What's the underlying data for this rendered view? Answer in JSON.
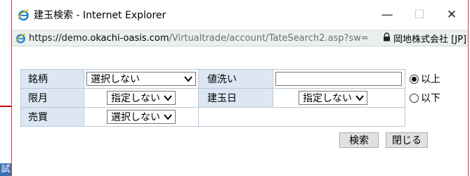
{
  "window": {
    "title": "建玉検索 - Internet Explorer",
    "minimize_glyph": "—",
    "maximize_glyph": "☐",
    "close_glyph": "✕"
  },
  "address_bar": {
    "url_scheme": "https://demo.",
    "url_host": "okachi-oasis.com",
    "url_path": "/Virtualtrade/account/TateSearch2.asp?sw=",
    "certificate": "岡地株式会社 [JP]",
    "icons": [
      "ie-icon",
      "lock-icon"
    ]
  },
  "form": {
    "meigara_label": "銘柄",
    "meigara_value": "選択しない",
    "nearai_label": "値洗い",
    "nearai_value": "",
    "gengetsu_label": "限月",
    "gengetsu_value": "指定しない",
    "tategyokubi_label": "建玉日",
    "tategyokubi_value": "指定しない",
    "baibai_label": "売買",
    "baibai_value": "選択しない",
    "radio_above_label": "以上",
    "radio_below_label": "以下",
    "radio_selected": "以上"
  },
  "buttons": {
    "search_label": "検索",
    "close_label": "閉じる"
  },
  "background": {
    "edge_text": "試"
  },
  "colors": {
    "label_cell_bg": "#dde7f3",
    "address_bar_bg": "#eaf0ed",
    "window_border": "#d23c3c"
  }
}
